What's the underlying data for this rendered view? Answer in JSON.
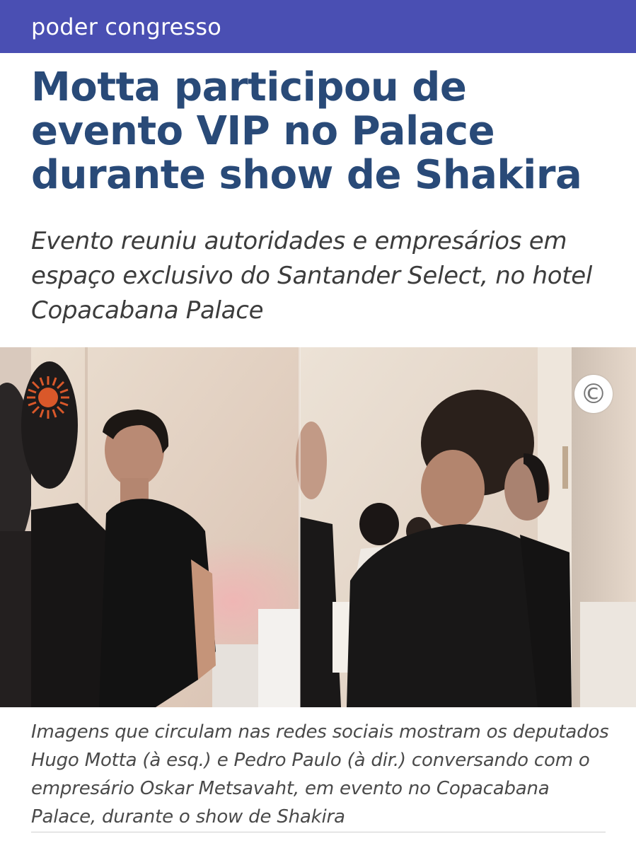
{
  "header": {
    "section_label": "poder congresso",
    "bar_color": "#4a4fb3"
  },
  "article": {
    "headline": "Motta participou de evento VIP no Palace durante show de Shakira",
    "subheadline": "Evento reuniu autoridades e empresários em espaço exclusivo do Santander Select, no hotel Copacabana Palace",
    "photo": {
      "description_icon": "copyright-icon",
      "copyright_symbol": "©",
      "logo_icon": "sun-logo-icon"
    },
    "caption": "Imagens que circulam nas redes sociais mostram os deputados Hugo Motta (à esq.) e Pedro Paulo (à dir.) conversando com o empresário Oskar Metsavaht, em evento no Copacabana Palace, durante o show de Shakira"
  },
  "colors": {
    "headline": "#294a78",
    "accent_logo": "#d9582a"
  }
}
